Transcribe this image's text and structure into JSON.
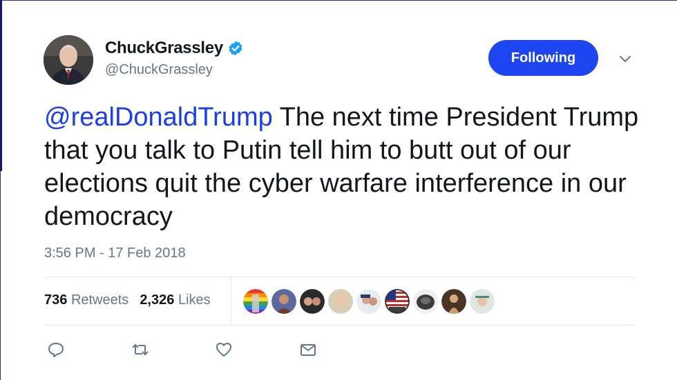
{
  "author": {
    "display_name": "ChuckGrassley",
    "handle": "@ChuckGrassley",
    "verified_icon": "verified-badge-icon"
  },
  "follow_button": {
    "label": "Following",
    "color": "#1e46f0"
  },
  "tweet": {
    "mention": "@realDonaldTrump",
    "text": " The next time President Trump that you talk to Putin tell him to butt out of our elections quit the cyber warfare interference in our democracy",
    "timestamp": "3:56 PM - 17 Feb 2018"
  },
  "stats": {
    "retweets_count": "736",
    "retweets_label": "Retweets",
    "likes_count": "2,326",
    "likes_label": "Likes"
  },
  "likers": [
    "liker-avatar-rainbow",
    "liker-avatar-2",
    "liker-avatar-3",
    "liker-avatar-4",
    "liker-avatar-5",
    "liker-avatar-flag",
    "liker-avatar-7",
    "liker-avatar-8",
    "liker-avatar-9"
  ],
  "actions": [
    "reply-icon",
    "retweet-icon",
    "like-icon",
    "direct-message-icon"
  ],
  "colors": {
    "mention": "#1b3fe6",
    "muted": "#657786",
    "text": "#14171a"
  }
}
